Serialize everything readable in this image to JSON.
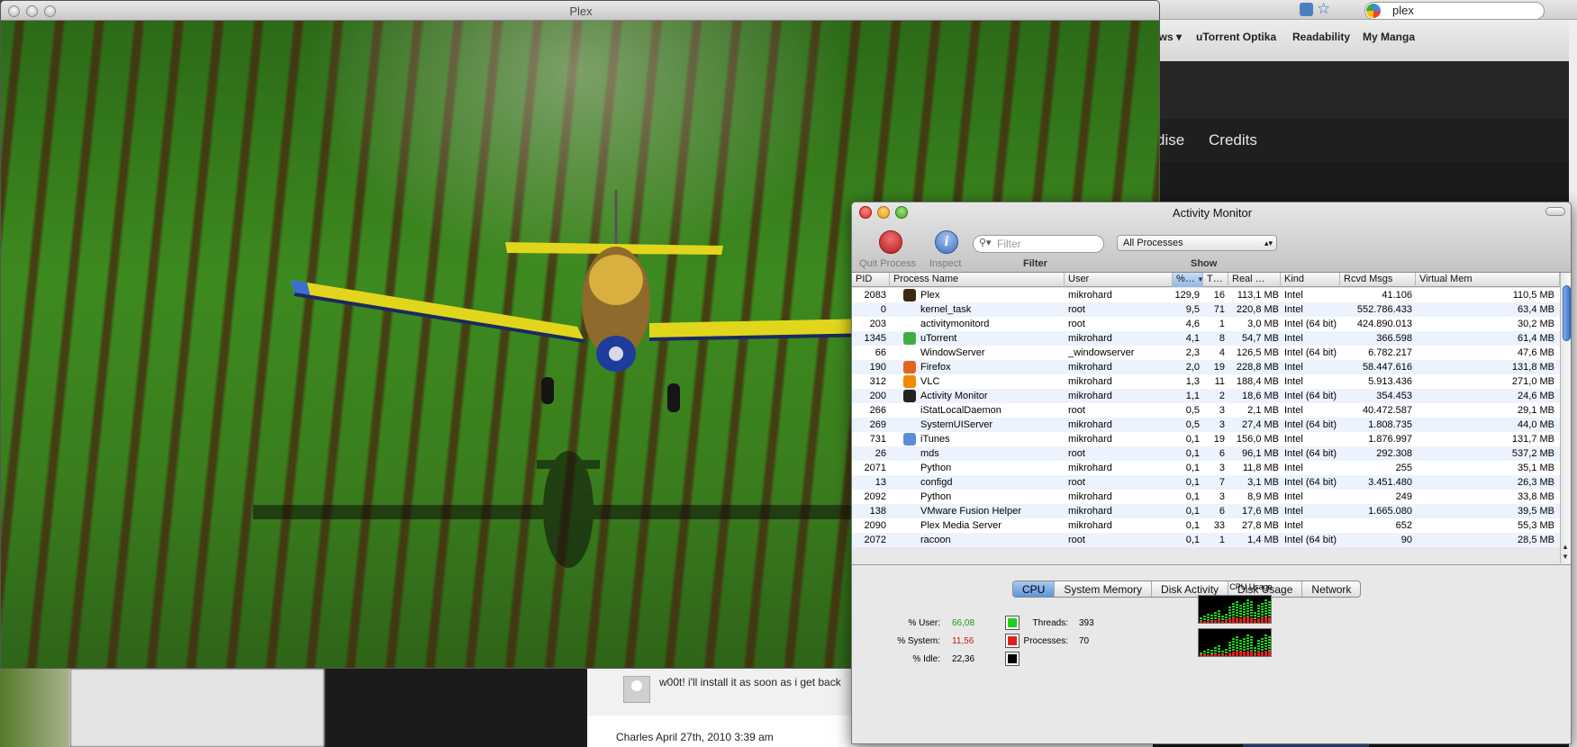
{
  "browser": {
    "bookmarks": [
      "ews ▾",
      "uTorrent Optika",
      "Readability",
      "My Manga"
    ],
    "search_value": "plex",
    "site_nav": [
      "dise",
      "Credits"
    ],
    "comment_text": "w00t! i'll install it as soon as i get back",
    "comment_author": "Charles April 27th, 2010 3:39 am"
  },
  "plex": {
    "title": "Plex"
  },
  "activity_monitor": {
    "title": "Activity Monitor",
    "toolbar": {
      "quit_label": "Quit Process",
      "inspect_label": "Inspect",
      "filter_placeholder": "Filter",
      "filter_label": "Filter",
      "show_value": "All Processes",
      "show_label": "Show"
    },
    "columns": [
      "PID",
      "Process Name",
      "User",
      "%…",
      "T…",
      "Real …",
      "Kind",
      "Rcvd Msgs",
      "Virtual Mem"
    ],
    "processes": [
      {
        "pid": "2083",
        "name": "Plex",
        "user": "mikrohard",
        "cpu": "129,9",
        "threads": "16",
        "real": "113,1 MB",
        "kind": "Intel",
        "msgs": "41.106",
        "vmem": "110,5 MB",
        "icon": "plex-icon",
        "color": "#3a2a12"
      },
      {
        "pid": "0",
        "name": "kernel_task",
        "user": "root",
        "cpu": "9,5",
        "threads": "71",
        "real": "220,8 MB",
        "kind": "Intel",
        "msgs": "552.786.433",
        "vmem": "63,4 MB",
        "icon": "",
        "color": ""
      },
      {
        "pid": "203",
        "name": "activitymonitord",
        "user": "root",
        "cpu": "4,6",
        "threads": "1",
        "real": "3,0 MB",
        "kind": "Intel (64 bit)",
        "msgs": "424.890.013",
        "vmem": "30,2 MB",
        "icon": "",
        "color": ""
      },
      {
        "pid": "1345",
        "name": "uTorrent",
        "user": "mikrohard",
        "cpu": "4,1",
        "threads": "8",
        "real": "54,7 MB",
        "kind": "Intel",
        "msgs": "366.598",
        "vmem": "61,4 MB",
        "icon": "utorrent-icon",
        "color": "#3fae3f"
      },
      {
        "pid": "66",
        "name": "WindowServer",
        "user": "_windowserver",
        "cpu": "2,3",
        "threads": "4",
        "real": "126,5 MB",
        "kind": "Intel (64 bit)",
        "msgs": "6.782.217",
        "vmem": "47,6 MB",
        "icon": "",
        "color": ""
      },
      {
        "pid": "190",
        "name": "Firefox",
        "user": "mikrohard",
        "cpu": "2,0",
        "threads": "19",
        "real": "228,8 MB",
        "kind": "Intel",
        "msgs": "58.447.616",
        "vmem": "131,8 MB",
        "icon": "firefox-icon",
        "color": "#e0661f"
      },
      {
        "pid": "312",
        "name": "VLC",
        "user": "mikrohard",
        "cpu": "1,3",
        "threads": "11",
        "real": "188,4 MB",
        "kind": "Intel",
        "msgs": "5.913.436",
        "vmem": "271,0 MB",
        "icon": "vlc-icon",
        "color": "#f08a00"
      },
      {
        "pid": "200",
        "name": "Activity Monitor",
        "user": "mikrohard",
        "cpu": "1,1",
        "threads": "2",
        "real": "18,6 MB",
        "kind": "Intel (64 bit)",
        "msgs": "354.453",
        "vmem": "24,6 MB",
        "icon": "activity-monitor-icon",
        "color": "#222"
      },
      {
        "pid": "266",
        "name": "iStatLocalDaemon",
        "user": "root",
        "cpu": "0,5",
        "threads": "3",
        "real": "2,1 MB",
        "kind": "Intel",
        "msgs": "40.472.587",
        "vmem": "29,1 MB",
        "icon": "",
        "color": ""
      },
      {
        "pid": "269",
        "name": "SystemUIServer",
        "user": "mikrohard",
        "cpu": "0,5",
        "threads": "3",
        "real": "27,4 MB",
        "kind": "Intel (64 bit)",
        "msgs": "1.808.735",
        "vmem": "44,0 MB",
        "icon": "",
        "color": ""
      },
      {
        "pid": "731",
        "name": "iTunes",
        "user": "mikrohard",
        "cpu": "0,1",
        "threads": "19",
        "real": "156,0 MB",
        "kind": "Intel",
        "msgs": "1.876.997",
        "vmem": "131,7 MB",
        "icon": "itunes-icon",
        "color": "#5a8fd8"
      },
      {
        "pid": "26",
        "name": "mds",
        "user": "root",
        "cpu": "0,1",
        "threads": "6",
        "real": "96,1 MB",
        "kind": "Intel (64 bit)",
        "msgs": "292.308",
        "vmem": "537,2 MB",
        "icon": "",
        "color": ""
      },
      {
        "pid": "2071",
        "name": "Python",
        "user": "mikrohard",
        "cpu": "0,1",
        "threads": "3",
        "real": "11,8 MB",
        "kind": "Intel",
        "msgs": "255",
        "vmem": "35,1 MB",
        "icon": "",
        "color": ""
      },
      {
        "pid": "13",
        "name": "configd",
        "user": "root",
        "cpu": "0,1",
        "threads": "7",
        "real": "3,1 MB",
        "kind": "Intel (64 bit)",
        "msgs": "3.451.480",
        "vmem": "26,3 MB",
        "icon": "",
        "color": ""
      },
      {
        "pid": "2092",
        "name": "Python",
        "user": "mikrohard",
        "cpu": "0,1",
        "threads": "3",
        "real": "8,9 MB",
        "kind": "Intel",
        "msgs": "249",
        "vmem": "33,8 MB",
        "icon": "",
        "color": ""
      },
      {
        "pid": "138",
        "name": "VMware Fusion Helper",
        "user": "mikrohard",
        "cpu": "0,1",
        "threads": "6",
        "real": "17,6 MB",
        "kind": "Intel",
        "msgs": "1.665.080",
        "vmem": "39,5 MB",
        "icon": "",
        "color": ""
      },
      {
        "pid": "2090",
        "name": "Plex Media Server",
        "user": "mikrohard",
        "cpu": "0,1",
        "threads": "33",
        "real": "27,8 MB",
        "kind": "Intel",
        "msgs": "652",
        "vmem": "55,3 MB",
        "icon": "",
        "color": ""
      },
      {
        "pid": "2072",
        "name": "racoon",
        "user": "root",
        "cpu": "0,1",
        "threads": "1",
        "real": "1,4 MB",
        "kind": "Intel (64 bit)",
        "msgs": "90",
        "vmem": "28,5 MB",
        "icon": "",
        "color": ""
      }
    ],
    "tabs": [
      "CPU",
      "System Memory",
      "Disk Activity",
      "Disk Usage",
      "Network"
    ],
    "active_tab": "CPU",
    "cpu": {
      "user_label": "% User:",
      "user_value": "66,08",
      "user_color": "#1fcf1f",
      "system_label": "% System:",
      "system_value": "11,56",
      "system_color": "#e02020",
      "idle_label": "% Idle:",
      "idle_value": "22,36",
      "idle_color": "#000000",
      "threads_label": "Threads:",
      "threads_value": "393",
      "processes_label": "Processes:",
      "processes_value": "70",
      "usage_label": "CPU Usage"
    }
  }
}
